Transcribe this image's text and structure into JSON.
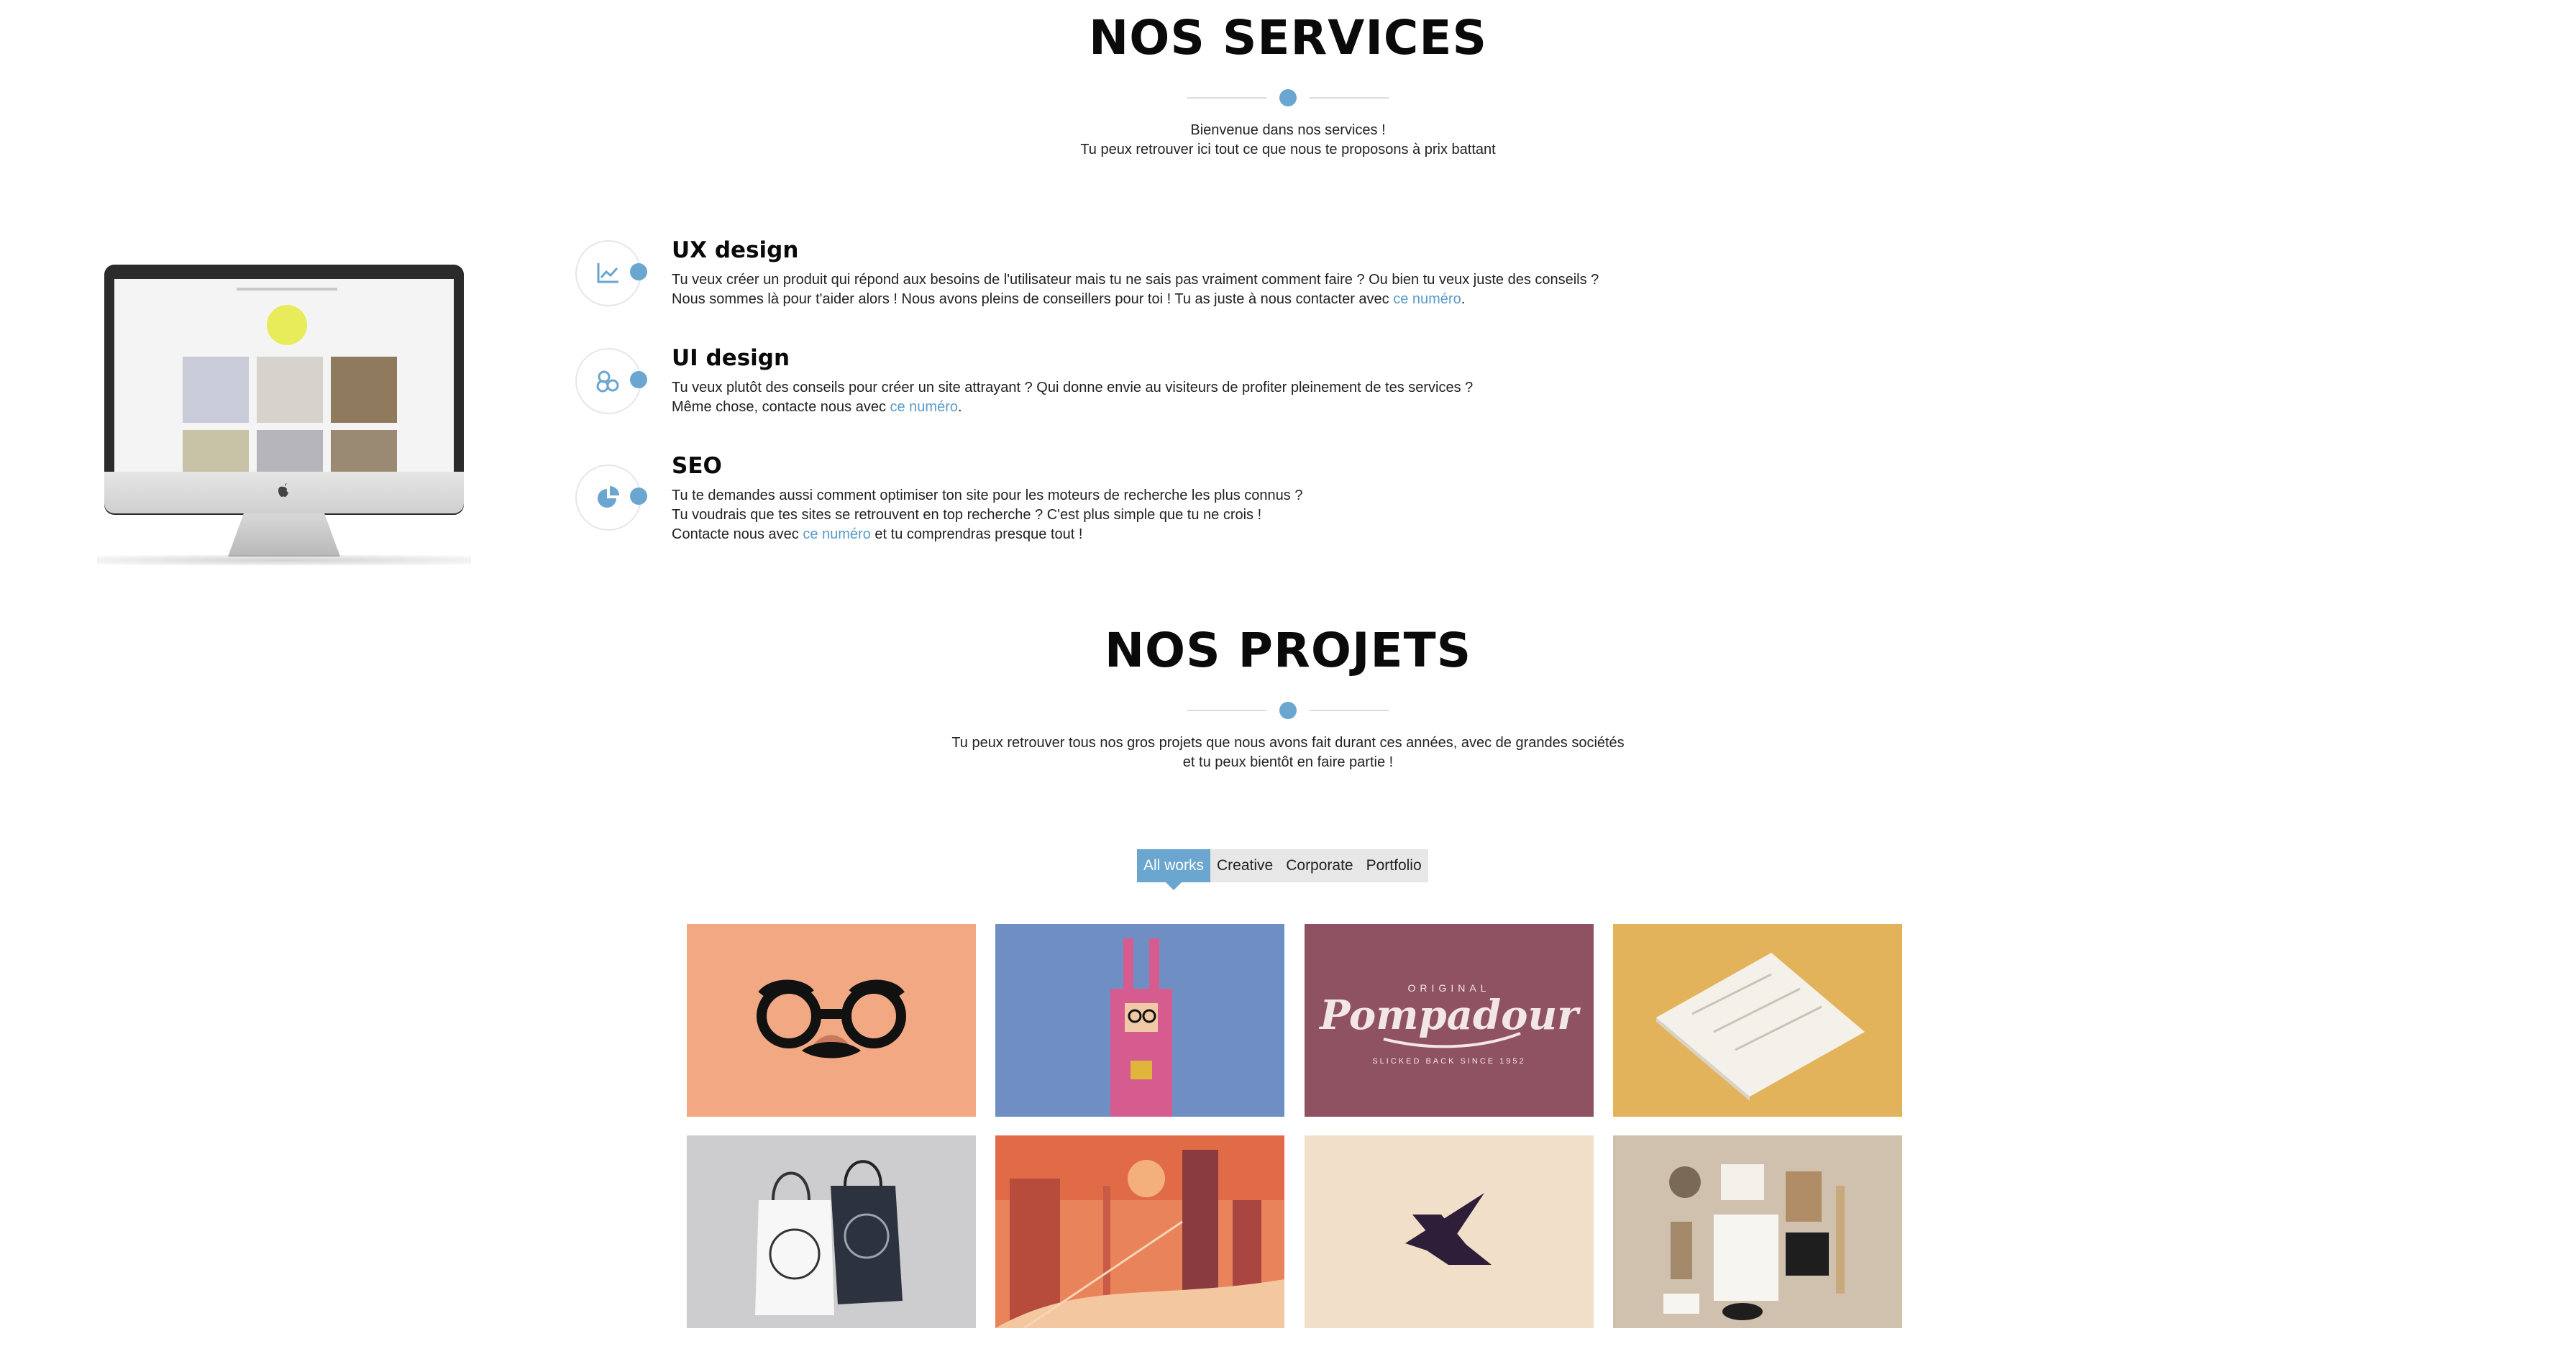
{
  "services_section": {
    "title": "NOS SERVICES",
    "intro_line1": "Bienvenue dans nos services !",
    "intro_line2": "Tu peux retrouver ici tout ce que nous te proposons à prix battant"
  },
  "services": [
    {
      "title": "UX design",
      "icon": "chart-line-icon",
      "line1": "Tu veux créer un produit qui répond aux besoins de l'utilisateur mais tu ne sais pas vraiment comment faire ? Ou bien tu veux juste des conseils ?",
      "line2_before": "Nous sommes là pour t'aider alors ! Nous avons pleins de conseillers pour toi ! Tu as juste à nous contacter avec ",
      "link": "ce numéro",
      "line2_after": "."
    },
    {
      "title": "UI design",
      "icon": "stack-icon",
      "line1": "Tu veux plutôt des conseils pour créer un site attrayant ? Qui donne envie au visiteurs de profiter pleinement de tes services ?",
      "line2_before": "Même chose, contacte nous avec ",
      "link": "ce numéro",
      "line2_after": "."
    },
    {
      "title": "SEO",
      "icon": "pie-chart-icon",
      "line1": "Tu te demandes aussi comment optimiser ton site pour les moteurs de recherche les plus connus ?",
      "line2": "Tu voudrais que tes sites se retrouvent en top recherche ? C'est plus simple que tu ne crois !",
      "line3_before": "Contacte nous avec ",
      "link": "ce numéro",
      "line3_after": " et tu comprendras presque tout !"
    }
  ],
  "projects_section": {
    "title": "NOS PROJETS",
    "intro_line1": "Tu peux retrouver tous nos gros projets que nous avons fait durant ces années, avec de grandes sociétés",
    "intro_line2": "et tu peux bientôt en faire partie !"
  },
  "filters": [
    "All works",
    "Creative",
    "Corporate",
    "Portfolio"
  ],
  "active_filter": "All works",
  "colors": {
    "accent": "#6aa6cf",
    "tile1": "#f2a983",
    "tile2": "#6f8fc4",
    "tile3": "#8f5262",
    "tile4": "#e3b35b",
    "tile5": "#cdcdcf",
    "tile6": "#e8835a",
    "tile7": "#f2dfca",
    "tile8": "#cfc1ad"
  },
  "portfolio_tiles": [
    {
      "name": "glasses-mustache-illustration"
    },
    {
      "name": "pink-rabbit-costume-illustration"
    },
    {
      "name": "pompadour-logo",
      "logo_text": "Pompadour",
      "logo_top": "ORIGINAL",
      "logo_bottom": "SLICKED BACK SINCE 1952"
    },
    {
      "name": "letterhead-paper-mockup"
    },
    {
      "name": "shopping-bags-mockup"
    },
    {
      "name": "city-sunset-illustration"
    },
    {
      "name": "abstract-bird-logo"
    },
    {
      "name": "stationery-branding-mockup"
    }
  ]
}
